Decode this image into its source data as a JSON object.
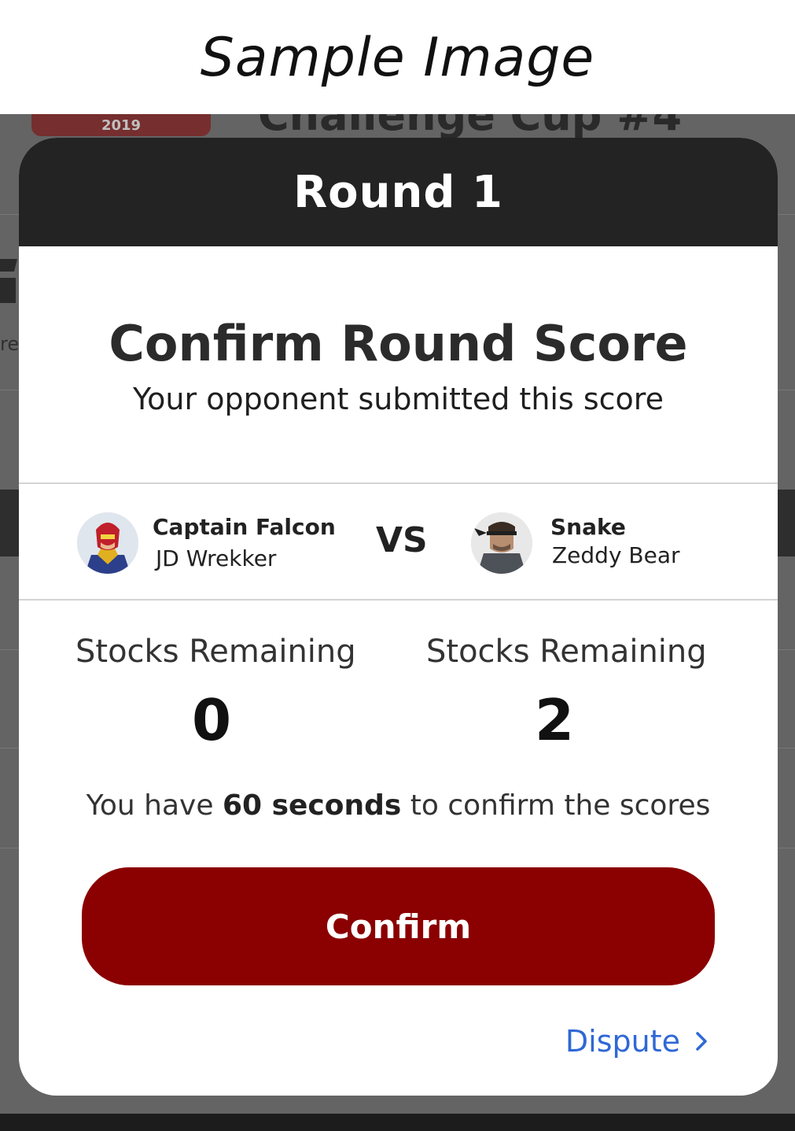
{
  "sample_header": {
    "title": "Sample Image"
  },
  "background": {
    "event_title": "Challenge Cup #4",
    "logo_year": "2019",
    "side_text": "re"
  },
  "modal": {
    "header_title": "Round 1",
    "confirm_title": "Confirm Round Score",
    "confirm_subtitle": "Your opponent submitted this score",
    "vs_label": "VS",
    "player1": {
      "character": "Captain Falcon",
      "tag": "JD Wrekker",
      "stocks_label": "Stocks Remaining",
      "stocks": "0"
    },
    "player2": {
      "character": "Snake",
      "tag": "Zeddy Bear",
      "stocks_label": "Stocks Remaining",
      "stocks": "2"
    },
    "timer": {
      "prefix": "You have ",
      "highlight": "60 seconds",
      "suffix": " to confirm the scores"
    },
    "confirm_button_label": "Confirm",
    "dispute_label": "Dispute"
  },
  "colors": {
    "header_bg": "#232323",
    "confirm_button": "#8b0000",
    "dispute_link": "#2f68d6",
    "backdrop": "#646464"
  },
  "icons": [
    "captain-falcon-avatar",
    "snake-avatar",
    "chevron-right-icon"
  ]
}
